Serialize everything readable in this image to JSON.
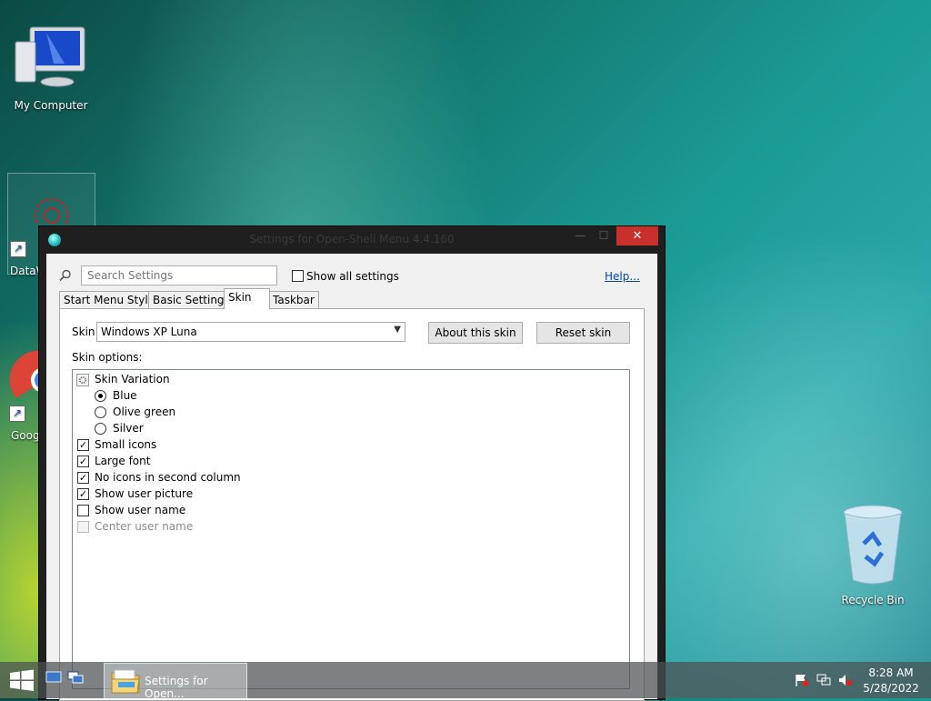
{
  "desktop": {
    "icons": [
      {
        "label": "My Computer"
      },
      {
        "label": "DataW"
      },
      {
        "label": "Goog"
      },
      {
        "label": "Recycle Bin"
      }
    ]
  },
  "window": {
    "title": "Settings for Open-Shell Menu 4.4.160",
    "controls": {
      "minimize": "—",
      "maximize": "☐",
      "close": "✕"
    }
  },
  "search": {
    "placeholder": "Search Settings",
    "value": ""
  },
  "show_all_settings": {
    "label": "Show all settings",
    "checked": false
  },
  "help_link": "Help...",
  "tabs": [
    {
      "label": "Start Menu Style",
      "active": false
    },
    {
      "label": "Basic Settings",
      "active": false
    },
    {
      "label": "Skin",
      "active": true
    },
    {
      "label": "Taskbar",
      "active": false
    }
  ],
  "skin": {
    "label": "Skin:",
    "selected": "Windows XP Luna",
    "about_button": "About this skin",
    "reset_button": "Reset skin",
    "options_label": "Skin options:",
    "variation_label": "Skin Variation",
    "variations": [
      {
        "label": "Blue",
        "selected": true
      },
      {
        "label": "Olive green",
        "selected": false
      },
      {
        "label": "Silver",
        "selected": false
      }
    ],
    "options": [
      {
        "label": "Small icons",
        "checked": true,
        "enabled": true
      },
      {
        "label": "Large font",
        "checked": true,
        "enabled": true
      },
      {
        "label": "No icons in second column",
        "checked": true,
        "enabled": true
      },
      {
        "label": "Show user picture",
        "checked": true,
        "enabled": true
      },
      {
        "label": "Show user name",
        "checked": false,
        "enabled": true
      },
      {
        "label": "Center user name",
        "checked": false,
        "enabled": false
      }
    ]
  },
  "taskbar": {
    "task_label": "Settings for Open...",
    "time": "8:28 AM",
    "date": "5/28/2022"
  },
  "icons": [
    "search-icon",
    "settings-gear-icon",
    "windows-logo-icon",
    "folder-icon",
    "flag-icon",
    "network-icon",
    "speaker-muted-icon"
  ]
}
